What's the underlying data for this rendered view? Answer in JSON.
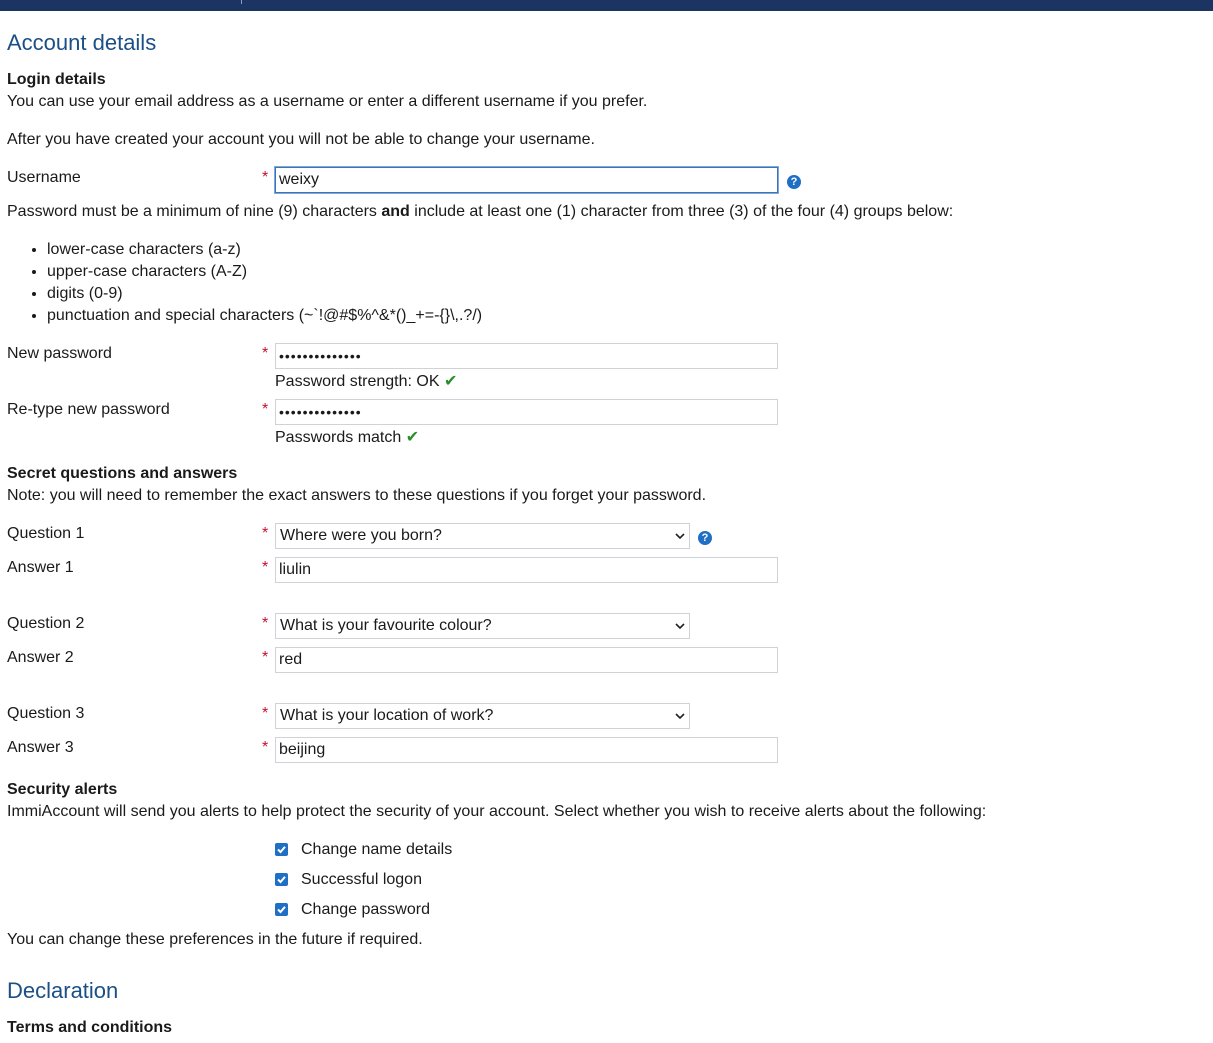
{
  "colors": {
    "topbar": "#1c3461",
    "heading": "#1b4f86",
    "required": "#c8102e",
    "accent": "#1f6fc5",
    "success": "#2a8c2a"
  },
  "account": {
    "heading": "Account details",
    "login_heading": "Login details",
    "login_line1": "You can use your email address as a username or enter a different username if you prefer.",
    "login_line2": "After you have created your account you will not be able to change your username.",
    "username_label": "Username",
    "username_value": "weixy",
    "required_mark": "*",
    "pw_rule_a": "Password must be a minimum of nine (9) characters ",
    "pw_rule_and": "and",
    "pw_rule_b": " include at least one (1) character from three (3) of the four (4) groups below:",
    "rules": [
      "lower-case characters (a-z)",
      "upper-case characters (A-Z)",
      "digits (0-9)",
      "punctuation and special characters (~`!@#$%^&*()_+=-{}\\,.?/)"
    ],
    "new_password_label": "New password",
    "new_password_value": "••••••••••••••",
    "strength_text": "Password strength: OK",
    "retype_label": "Re-type new password",
    "retype_value": "••••••••••••••",
    "match_text": "Passwords match"
  },
  "secret": {
    "heading": "Secret questions and answers",
    "note": "Note: you will need to remember the exact answers to these questions if you forget your password.",
    "q1_label": "Question 1",
    "q1_value": "Where were you born?",
    "a1_label": "Answer 1",
    "a1_value": "liulin",
    "q2_label": "Question 2",
    "q2_value": "What is your favourite colour?",
    "a2_label": "Answer 2",
    "a2_value": "red",
    "q3_label": "Question 3",
    "q3_value": "What is your location of work?",
    "a3_label": "Answer 3",
    "a3_value": "beijing"
  },
  "alerts": {
    "heading": "Security alerts",
    "text": "ImmiAccount will send you alerts to help protect the security of your account. Select whether you wish to receive alerts about the following:",
    "options": [
      {
        "label": "Change name details",
        "checked": true
      },
      {
        "label": "Successful logon",
        "checked": true
      },
      {
        "label": "Change password",
        "checked": true
      }
    ],
    "footnote": "You can change these preferences in the future if required."
  },
  "declaration": {
    "heading": "Declaration",
    "terms_heading": "Terms and conditions"
  },
  "icons": {
    "help": "help-circle-icon",
    "check": "checkmark-icon",
    "dropdown": "chevron-down-icon"
  },
  "glyphs": {
    "help": "?",
    "check": "✔"
  }
}
